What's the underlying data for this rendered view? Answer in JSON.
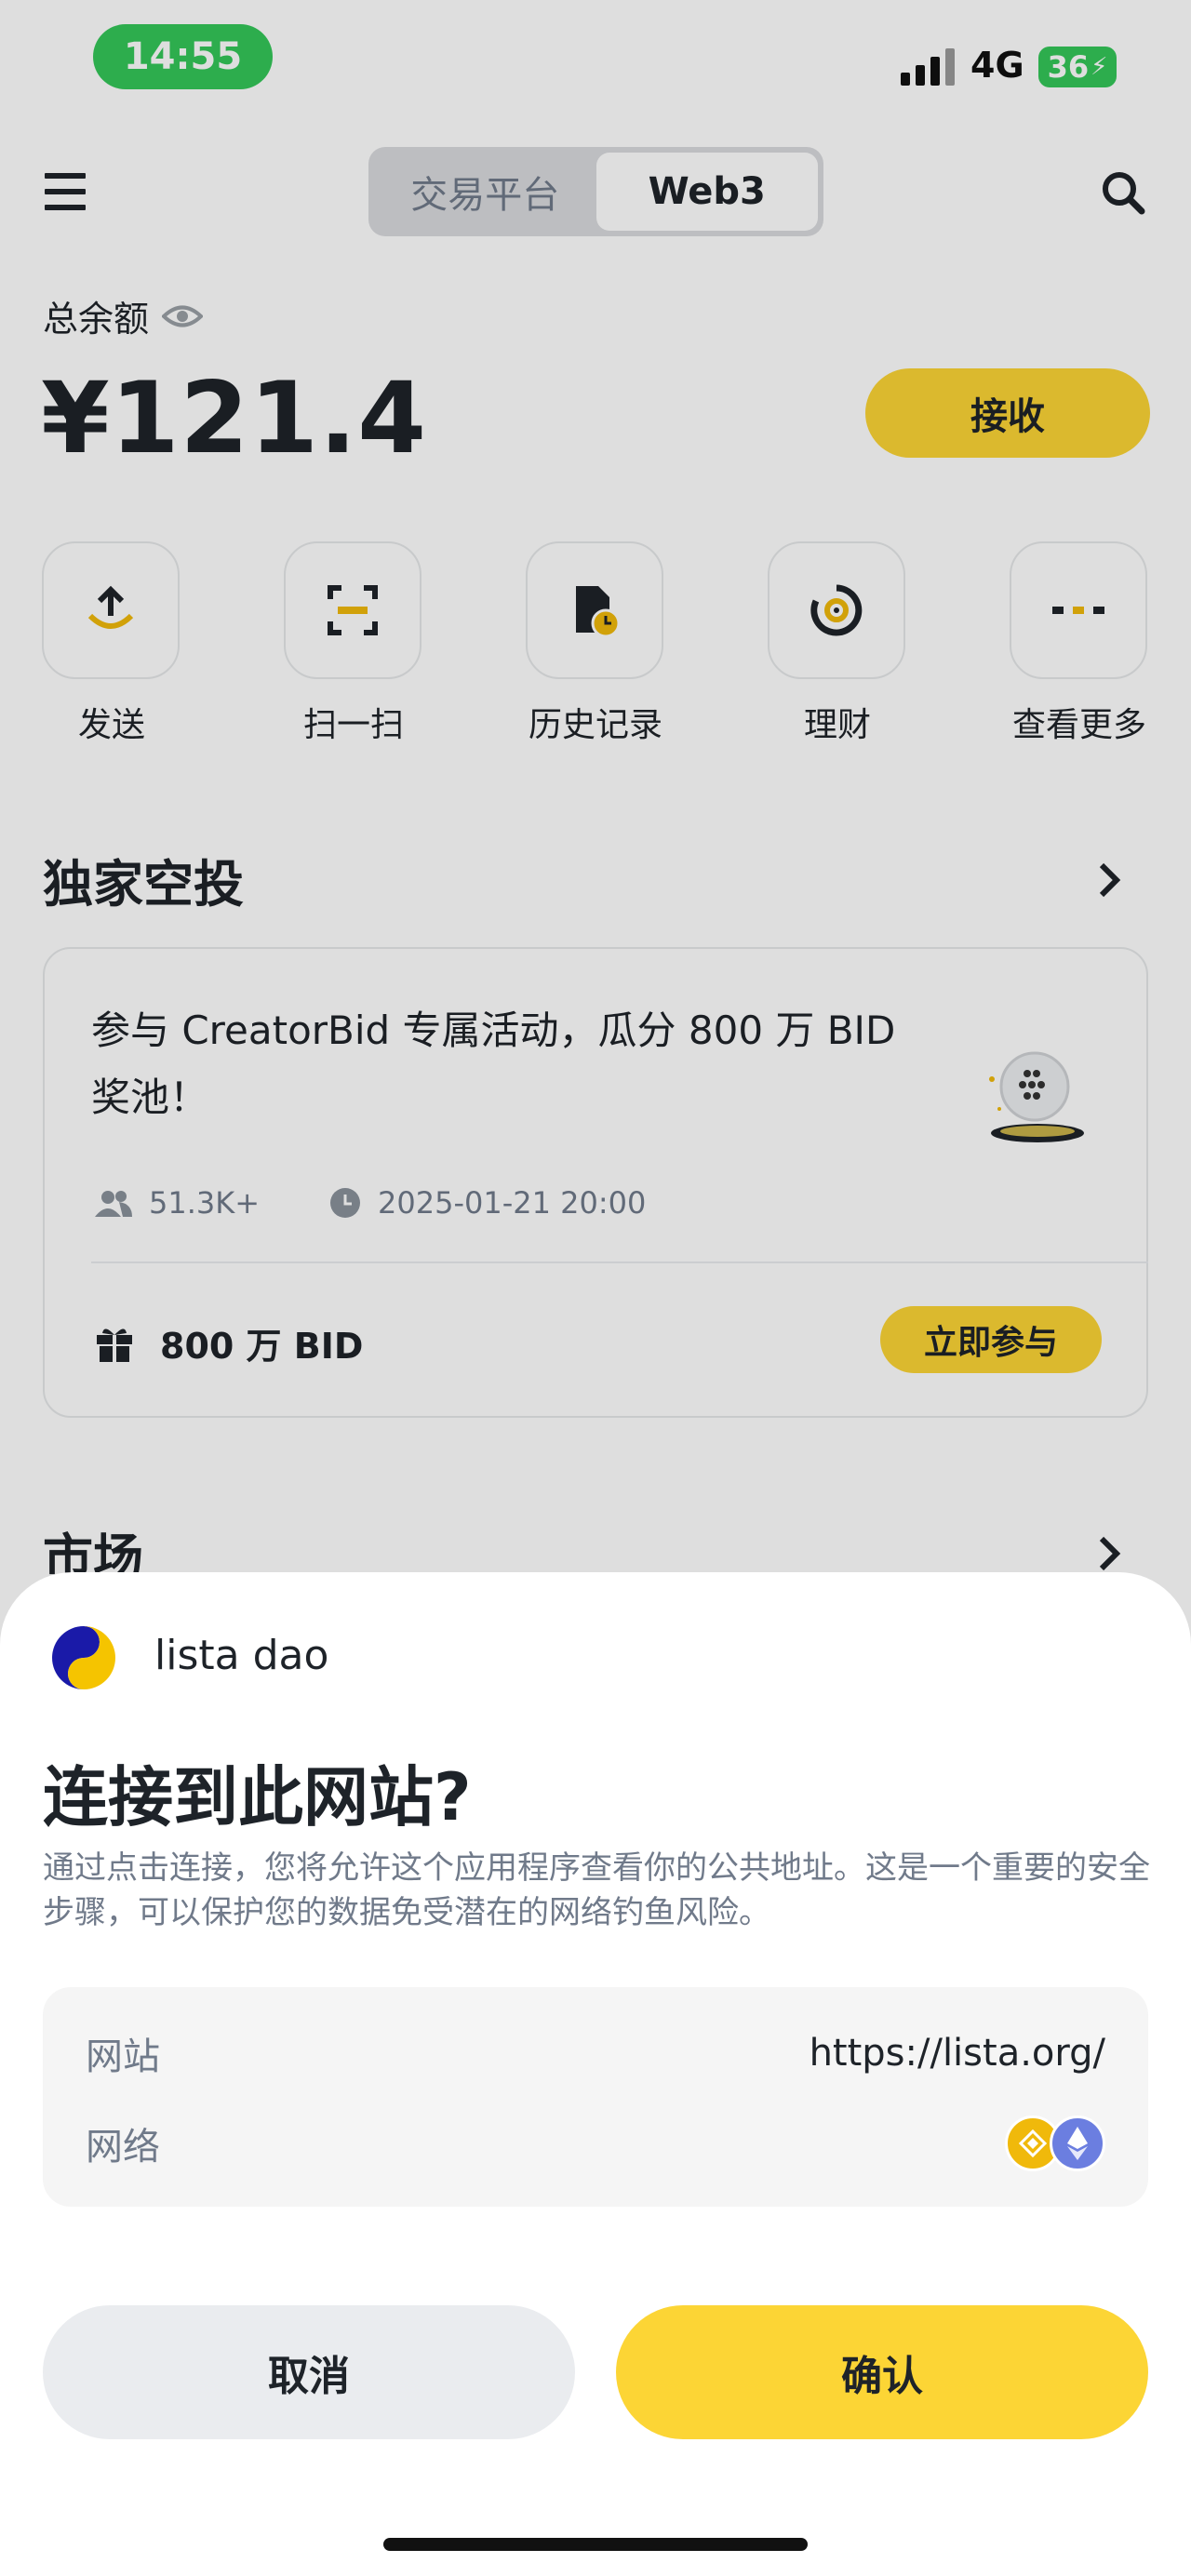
{
  "status_bar": {
    "time": "14:55",
    "network": "4G",
    "battery": "36"
  },
  "header": {
    "tabs": [
      {
        "label": "交易平台",
        "active": false
      },
      {
        "label": "Web3",
        "active": true
      }
    ]
  },
  "balance": {
    "label": "总余额",
    "value": "¥121.4",
    "receive_label": "接收"
  },
  "actions": [
    {
      "label": "发送",
      "icon": "send-icon"
    },
    {
      "label": "扫一扫",
      "icon": "scan-icon"
    },
    {
      "label": "历史记录",
      "icon": "history-icon"
    },
    {
      "label": "理财",
      "icon": "earn-icon"
    },
    {
      "label": "查看更多",
      "icon": "more-icon"
    }
  ],
  "airdrop": {
    "section_title": "独家空投",
    "card": {
      "title": "参与 CreatorBid 专属活动，瓜分 800 万 BID 奖池！",
      "participants": "51.3K+",
      "date": "2025-01-21 20:00",
      "reward": "800 万 BID",
      "join_label": "立即参与"
    }
  },
  "market": {
    "section_title": "市场"
  },
  "sheet": {
    "dapp_name": "lista dao",
    "title": "连接到此网站?",
    "description": "通过点击连接，您将允许这个应用程序查看你的公共地址。这是一个重要的安全步骤，可以保护您的数据免受潜在的网络钓鱼风险。",
    "site_label": "网站",
    "site_value": "https://lista.org/",
    "network_label": "网络",
    "network_icons": [
      "bnb-chain-icon",
      "ethereum-icon"
    ],
    "cancel_label": "取消",
    "confirm_label": "确认"
  },
  "colors": {
    "accent": "#fcd535",
    "text": "#1e2329",
    "muted": "#707a8a",
    "status_green": "#34c759"
  }
}
